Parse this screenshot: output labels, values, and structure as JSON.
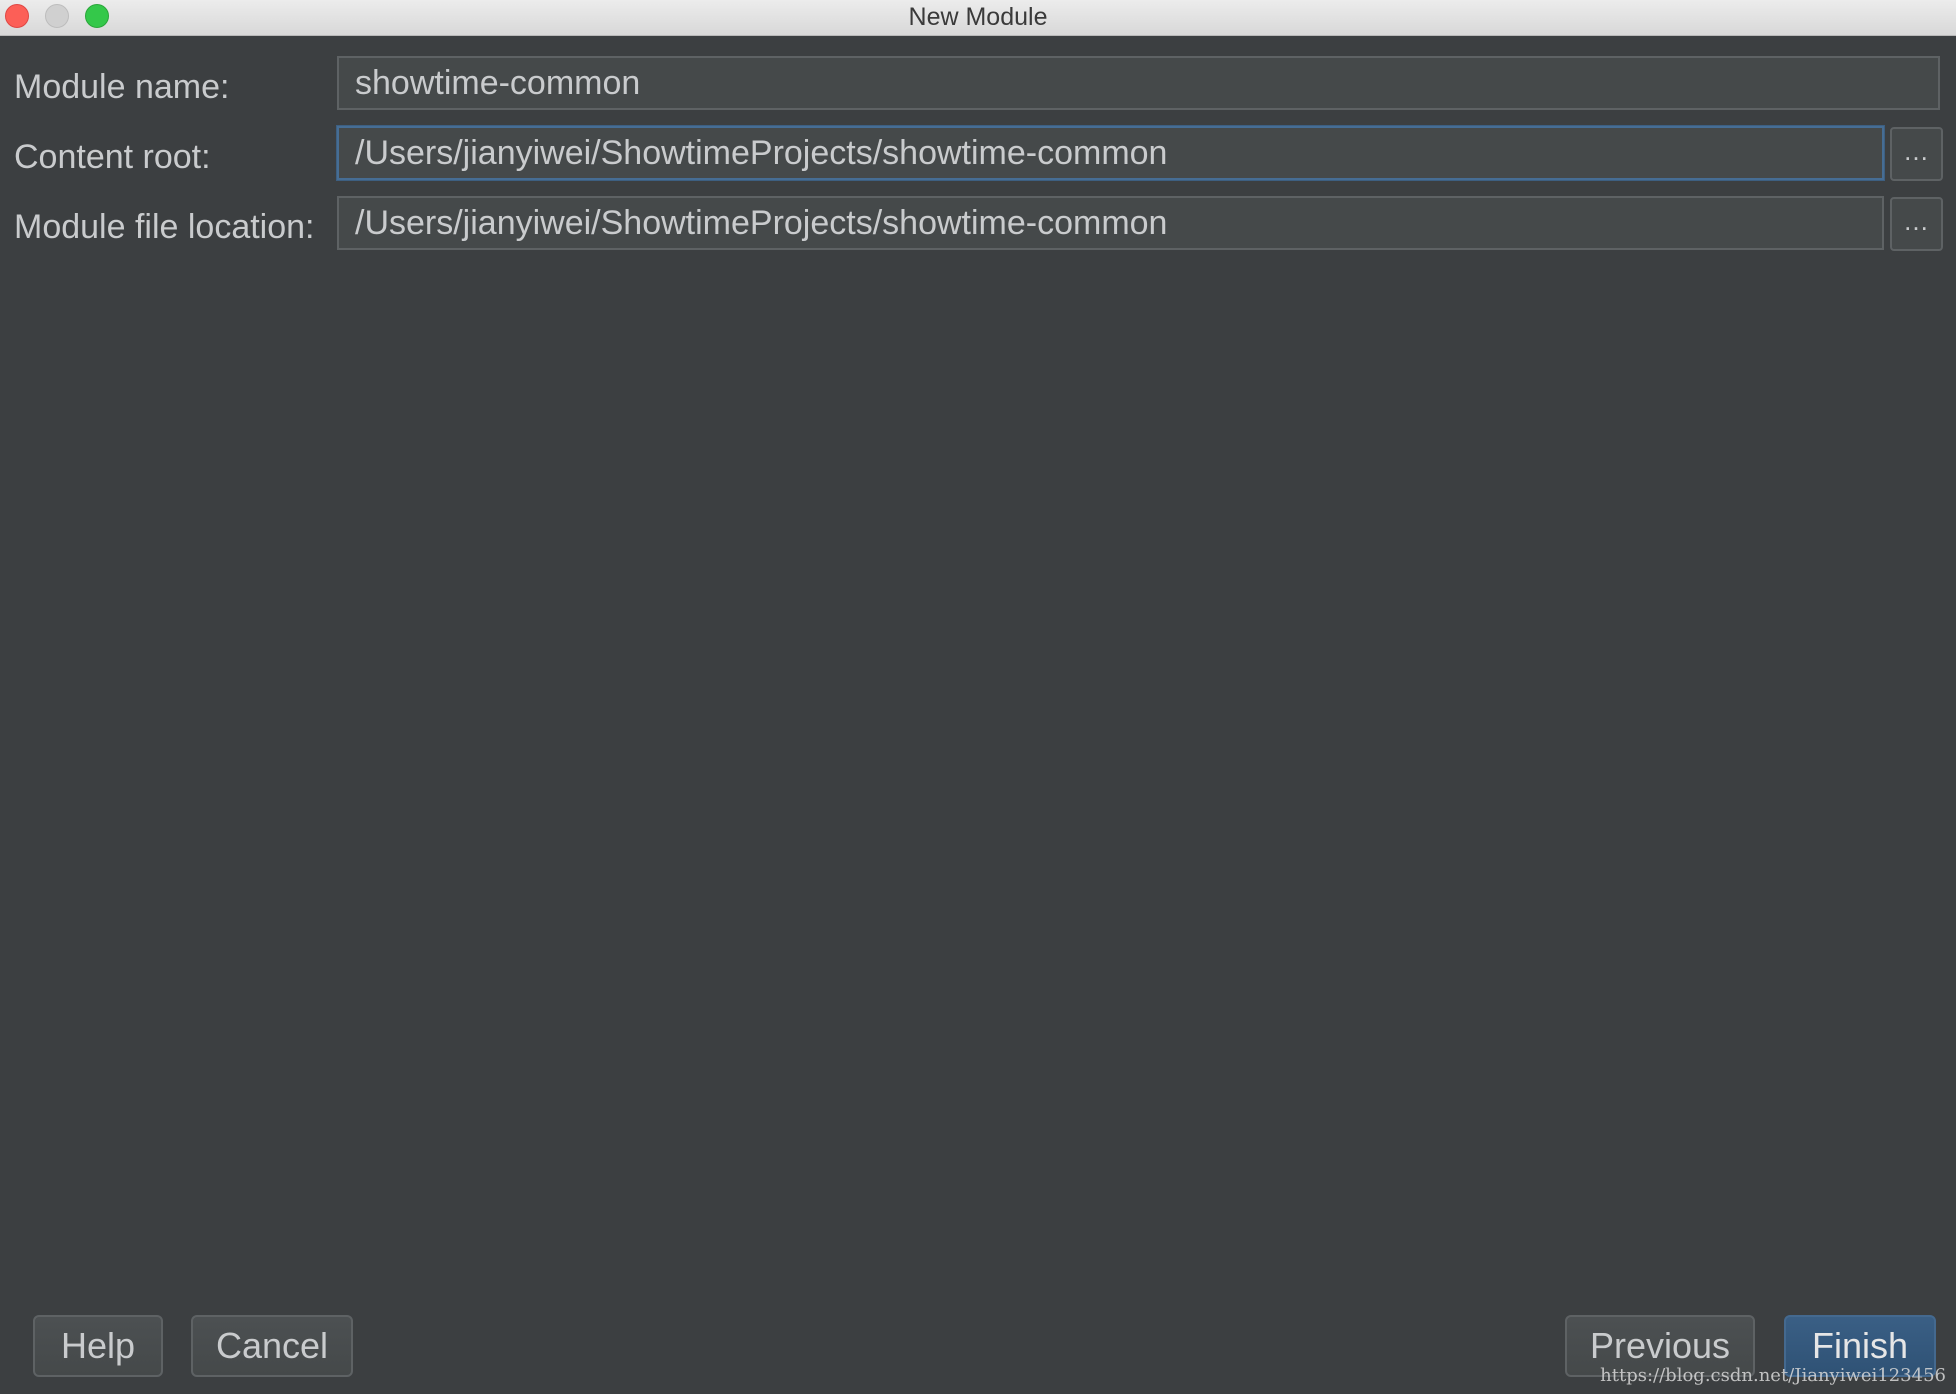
{
  "window": {
    "title": "New Module"
  },
  "form": {
    "module_name": {
      "label": "Module name:",
      "value": "showtime-common"
    },
    "content_root": {
      "label": "Content root:",
      "value": "/Users/jianyiwei/ShowtimeProjects/showtime-common",
      "browse_label": "..."
    },
    "module_file_location": {
      "label": "Module file location:",
      "value": "/Users/jianyiwei/ShowtimeProjects/showtime-common",
      "browse_label": "..."
    }
  },
  "buttons": {
    "help": "Help",
    "cancel": "Cancel",
    "previous": "Previous",
    "finish": "Finish"
  },
  "watermark": "https://blog.csdn.net/Jianyiwei123456"
}
